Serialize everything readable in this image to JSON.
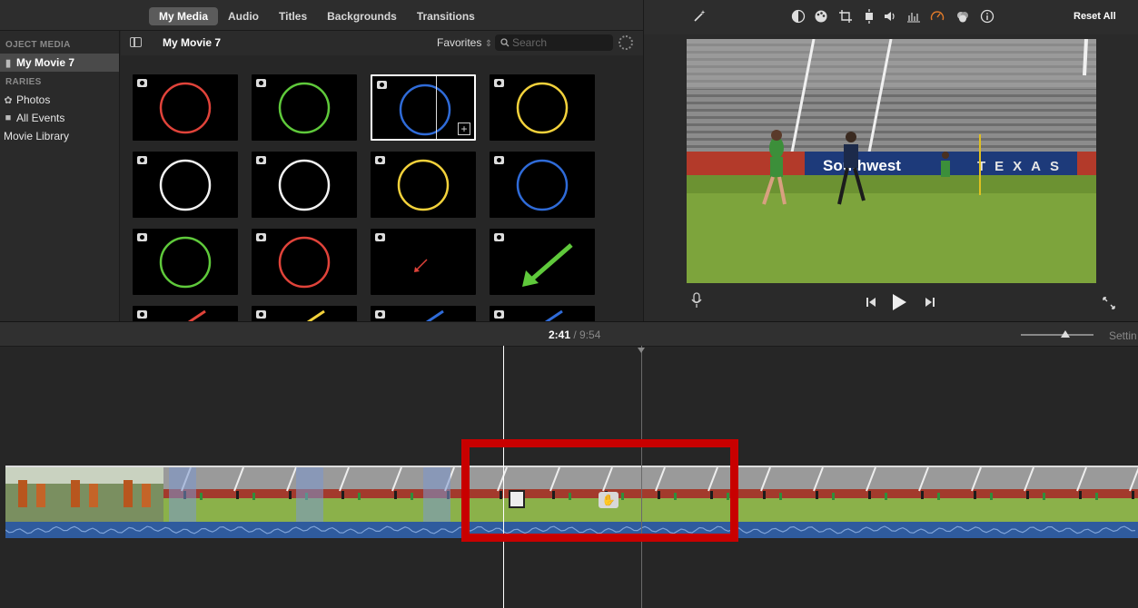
{
  "tabs": [
    "My Media",
    "Audio",
    "Titles",
    "Backgrounds",
    "Transitions"
  ],
  "sidebar": {
    "project_heading": "OJECT MEDIA",
    "project_item": "My Movie 7",
    "libraries_heading": "RARIES",
    "items": [
      "Photos",
      "All Events",
      "Movie Library"
    ]
  },
  "browser": {
    "project_title": "My Movie 7",
    "favorites": "Favorites",
    "search_placeholder": "Search"
  },
  "thumbnails": [
    {
      "shape": "circle",
      "color": "#e0433a"
    },
    {
      "shape": "circle",
      "color": "#5fc93b"
    },
    {
      "shape": "circle",
      "color": "#2f6bd8",
      "selected": true
    },
    {
      "shape": "circle",
      "color": "#f2d13b"
    },
    {
      "shape": "circle",
      "color": "#f2f2f2"
    },
    {
      "shape": "circle",
      "color": "#f2f2f2"
    },
    {
      "shape": "circle",
      "color": "#f2d13b"
    },
    {
      "shape": "circle",
      "color": "#2f6bd8"
    },
    {
      "shape": "circle",
      "color": "#5fc93b"
    },
    {
      "shape": "circle",
      "color": "#e0433a"
    },
    {
      "shape": "arrow-small",
      "color": "#e0433a"
    },
    {
      "shape": "arrow-large",
      "color": "#5fc93b"
    },
    {
      "shape": "arrow-stub",
      "color": "#e0433a"
    },
    {
      "shape": "arrow-stub",
      "color": "#f2d13b"
    },
    {
      "shape": "arrow-stub",
      "color": "#2f6bd8"
    },
    {
      "shape": "arrow-stub",
      "color": "#2f6bd8"
    }
  ],
  "viewer": {
    "reset_label": "Reset All",
    "tool_icons": [
      "magic-wand-icon",
      "color-balance-icon",
      "color-correction-icon",
      "crop-icon",
      "stabilization-icon",
      "volume-icon",
      "equalizer-icon",
      "speed-icon",
      "clip-filter-icon",
      "info-icon"
    ],
    "speed_color": "#e07a2a",
    "video_banner": "Southwest",
    "video_banner2": "TEXAS"
  },
  "timeline": {
    "current_time": "2:41",
    "total_time": "9:54",
    "settings_label": "Settin"
  },
  "colors": {
    "highlight": "#c80000",
    "audio_wave": "#2f5b9e"
  }
}
